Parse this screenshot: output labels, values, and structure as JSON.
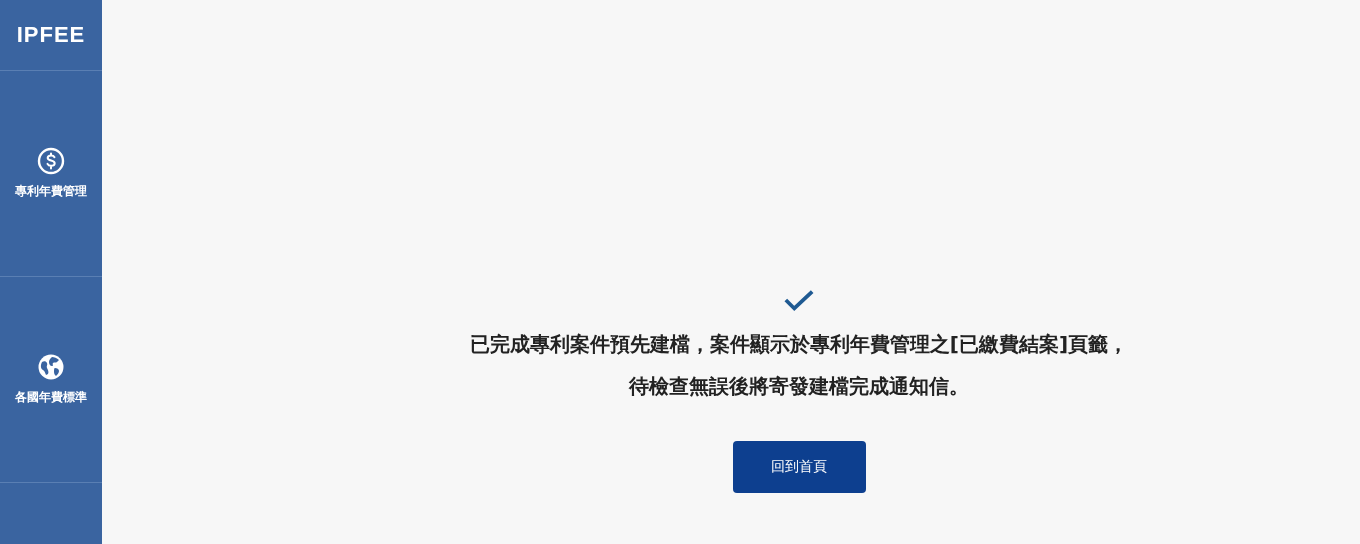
{
  "sidebar": {
    "logo": "IPFEE",
    "items": [
      {
        "kind": "dollar",
        "label": "專利年費管理"
      },
      {
        "kind": "globe",
        "label": "各國年費標準"
      }
    ]
  },
  "message": {
    "lines": [
      "已完成專利案件預先建檔，案件顯示於專利年費管理之[已繳費結案]頁籤，",
      "待檢查無誤後將寄發建檔完成通知信。"
    ]
  },
  "buttons": [
    "回到首頁"
  ]
}
